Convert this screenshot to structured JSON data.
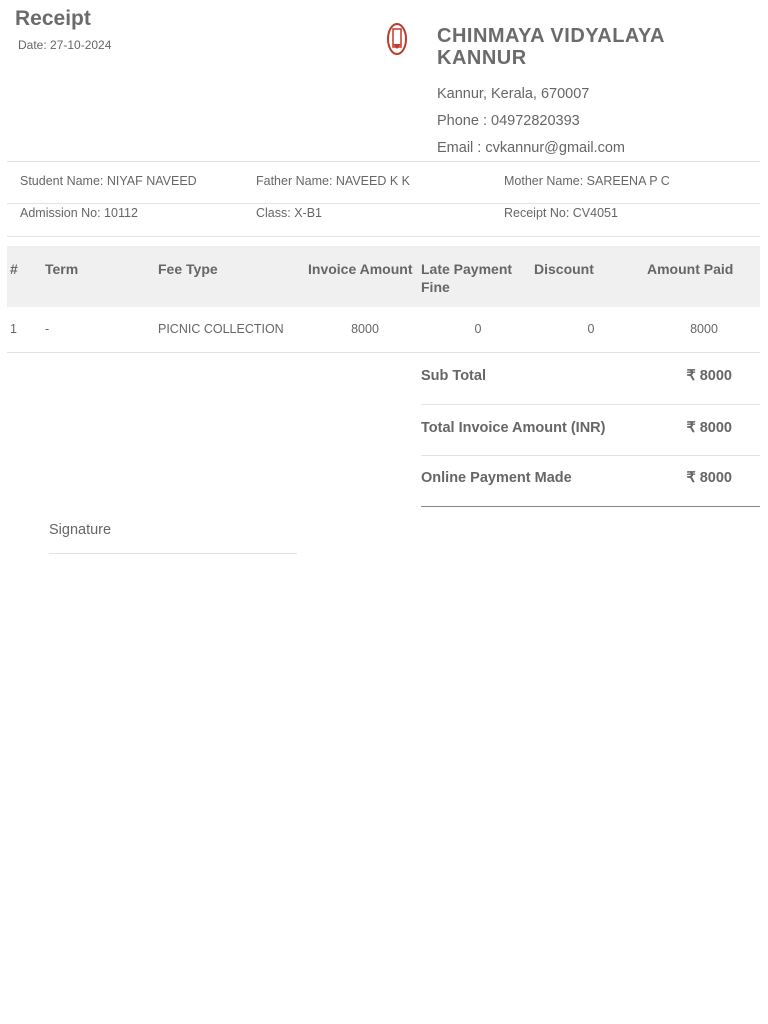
{
  "title": "Receipt",
  "date": "Date: 27-10-2024",
  "school": {
    "name_line1": "CHINMAYA VIDYALAYA",
    "name_line2": "KANNUR",
    "address": "Kannur, Kerala, 670007",
    "phone": "Phone : 04972820393",
    "email": "Email : cvkannur@gmail.com",
    "logo": "school-emblem",
    "logo_color": "#c0392b"
  },
  "info": {
    "student": "Student Name: NIYAF NAVEED",
    "father": "Father Name: NAVEED K K",
    "mother": "Mother Name: SAREENA P C",
    "admission": "Admission No: 10112",
    "class": "Class: X-B1",
    "receipt_no": "Receipt No: CV4051"
  },
  "table": {
    "headers": [
      "#",
      "Term",
      "Fee Type",
      "Invoice Amount",
      "Late Payment Fine",
      "Discount",
      "Amount Paid"
    ],
    "rows": [
      [
        "1",
        "-",
        "PICNIC COLLECTION",
        "8000",
        "0",
        "0",
        "8000"
      ]
    ]
  },
  "totals": [
    {
      "label": "Sub Total",
      "value": "₹ 8000"
    },
    {
      "label": "Total Invoice Amount (INR)",
      "value": "₹ 8000"
    },
    {
      "label": "Online Payment Made",
      "value": "₹ 8000"
    }
  ],
  "signature": "Signature"
}
